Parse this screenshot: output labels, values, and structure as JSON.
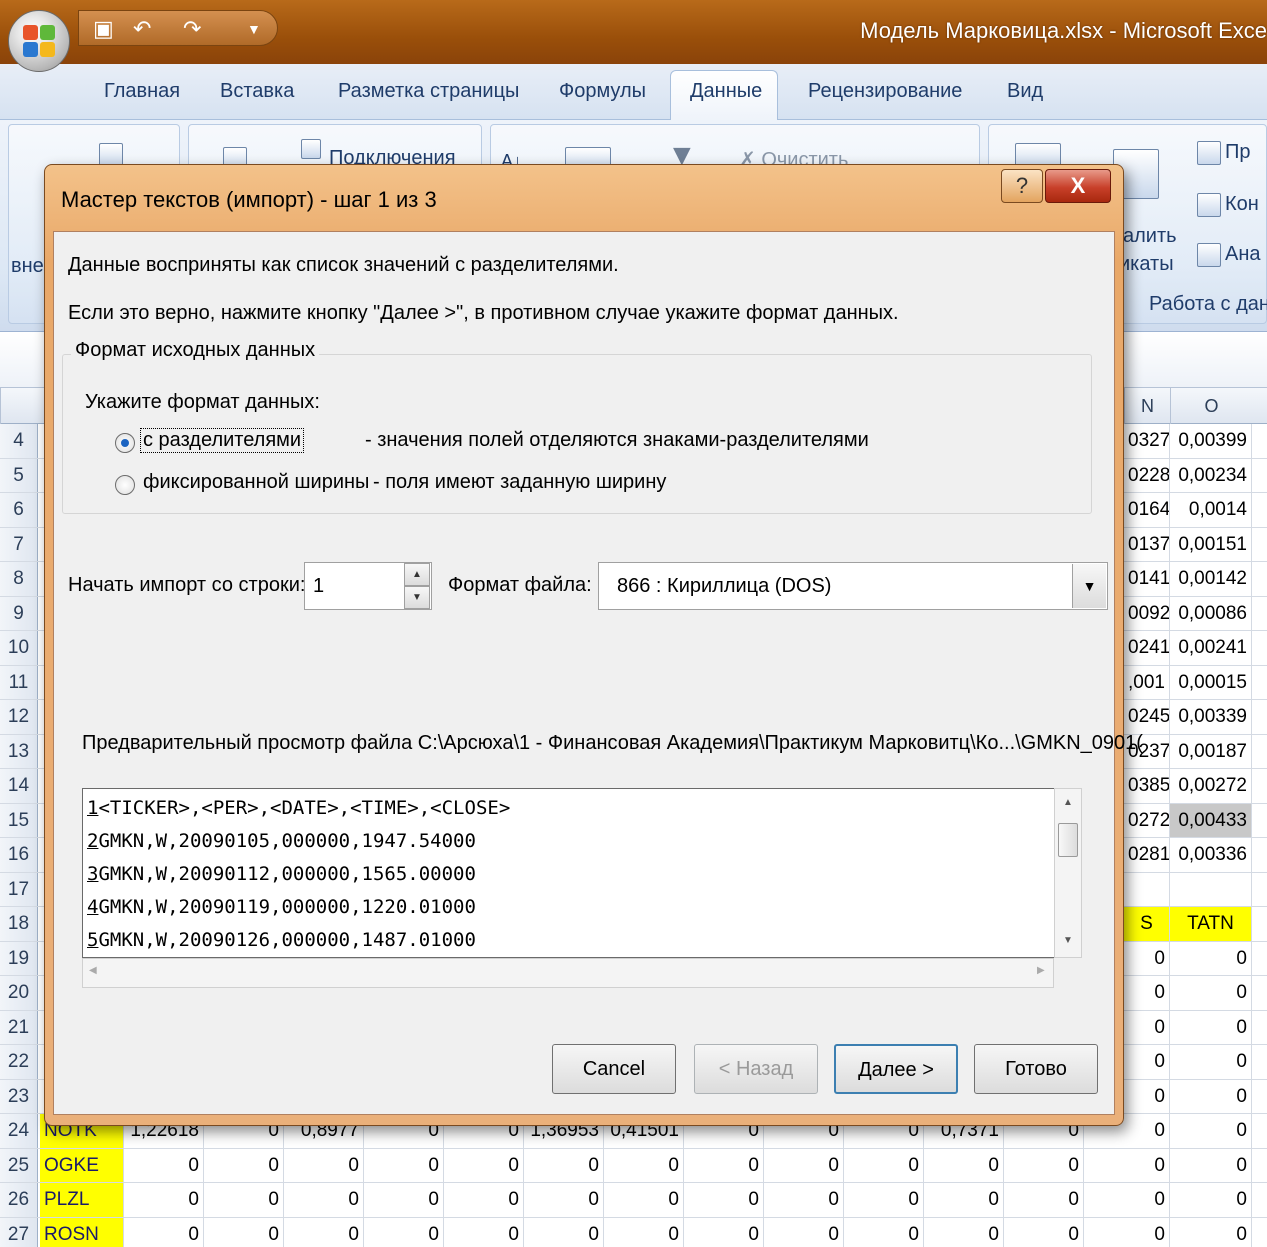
{
  "window": {
    "title": "Модель Марковица.xlsx - Microsoft Exce"
  },
  "ribbon": {
    "tabs": [
      "Главная",
      "Вставка",
      "Разметка страницы",
      "Формулы",
      "Данные",
      "Рецензирование",
      "Вид"
    ],
    "active_tab": "Данные",
    "connections_label": "Подключения",
    "clear_label": "Очистить",
    "left_cut_label": "вне",
    "remove_label": "алить",
    "duplicates_label": "икаты",
    "group_label": "Работа с данны",
    "right_items": [
      "Пр",
      "Кон",
      "Ана"
    ]
  },
  "sheet": {
    "col_headers": [
      "N",
      "O"
    ],
    "rows": [
      {
        "num": "4",
        "n": "0327",
        "o": "0,00399"
      },
      {
        "num": "5",
        "n": "0228",
        "o": "0,00234"
      },
      {
        "num": "6",
        "n": "0164",
        "o": "0,0014"
      },
      {
        "num": "7",
        "n": "0137",
        "o": "0,00151"
      },
      {
        "num": "8",
        "n": "0141",
        "o": "0,00142"
      },
      {
        "num": "9",
        "n": "0092",
        "o": "0,00086"
      },
      {
        "num": "10",
        "n": "0241",
        "o": "0,00241"
      },
      {
        "num": "11",
        "n": ",001",
        "o": "0,00015"
      },
      {
        "num": "12",
        "n": "0245",
        "o": "0,00339"
      },
      {
        "num": "13",
        "n": "0237",
        "o": "0,00187"
      },
      {
        "num": "14",
        "n": "0385",
        "o": "0,00272"
      },
      {
        "num": "15",
        "n": "0272",
        "o": "0,00433"
      },
      {
        "num": "16",
        "n": "0281",
        "o": "0,00336"
      },
      {
        "num": "17",
        "n": "",
        "o": ""
      },
      {
        "num": "18",
        "n": "S",
        "o": "TATN"
      },
      {
        "num": "19",
        "n": "0",
        "o": "0"
      },
      {
        "num": "20",
        "n": "0",
        "o": "0"
      },
      {
        "num": "21",
        "n": "0",
        "o": "0"
      },
      {
        "num": "22",
        "n": "0",
        "o": "0"
      },
      {
        "num": "23",
        "n": "0",
        "o": "0"
      }
    ],
    "bottom_rows": [
      {
        "num": "24",
        "ticker": "NOTK",
        "values": [
          "1,22618",
          "0",
          "0,8977",
          "0",
          "0",
          "1,36953",
          "0,41501",
          "0",
          "0",
          "0",
          "0,7371",
          "0",
          "0",
          "0"
        ]
      },
      {
        "num": "25",
        "ticker": "OGKE",
        "values": [
          "0",
          "0",
          "0",
          "0",
          "0",
          "0",
          "0",
          "0",
          "0",
          "0",
          "0",
          "0",
          "0",
          "0"
        ]
      },
      {
        "num": "26",
        "ticker": "PLZL",
        "values": [
          "0",
          "0",
          "0",
          "0",
          "0",
          "0",
          "0",
          "0",
          "0",
          "0",
          "0",
          "0",
          "0",
          "0"
        ]
      },
      {
        "num": "27",
        "ticker": "ROSN",
        "values": [
          "0",
          "0",
          "0",
          "0",
          "0",
          "0",
          "0",
          "0",
          "0",
          "0",
          "0",
          "0",
          "0",
          "0"
        ]
      }
    ]
  },
  "dialog": {
    "title": "Мастер текстов (импорт) - шаг 1 из 3",
    "help": "?",
    "close": "X",
    "line1": "Данные восприняты как список значений с разделителями.",
    "line2": "Если это верно, нажмите кнопку \"Далее >\", в противном случае укажите формат данных.",
    "group_title": "Формат исходных данных",
    "prompt": "Укажите формат данных:",
    "options": [
      {
        "label": "с разделителями",
        "desc": "- значения полей отделяются знаками-разделителями",
        "selected": true
      },
      {
        "label": "фиксированной ширины",
        "desc": "- поля имеют заданную ширину",
        "selected": false
      }
    ],
    "start_row_label": "Начать импорт со строки:",
    "start_row_value": "1",
    "file_origin_label": "Формат файла:",
    "file_origin_value": "866 : Кириллица (DOS)",
    "preview_label": "Предварительный просмотр файла C:\\Арсюха\\1 - Финансовая Академия\\Практикум Марковитц\\Ко...\\GMKN_0901(",
    "preview_lines": [
      {
        "n": "1",
        "text": "<TICKER>,<PER>,<DATE>,<TIME>,<CLOSE>"
      },
      {
        "n": "2",
        "text": "GMKN,W,20090105,000000,1947.54000"
      },
      {
        "n": "3",
        "text": "GMKN,W,20090112,000000,1565.00000"
      },
      {
        "n": "4",
        "text": "GMKN,W,20090119,000000,1220.01000"
      },
      {
        "n": "5",
        "text": "GMKN,W,20090126,000000,1487.01000"
      }
    ],
    "buttons": {
      "cancel": "Cancel",
      "back": "< Назад",
      "next": "Далее >",
      "finish": "Готово"
    }
  }
}
